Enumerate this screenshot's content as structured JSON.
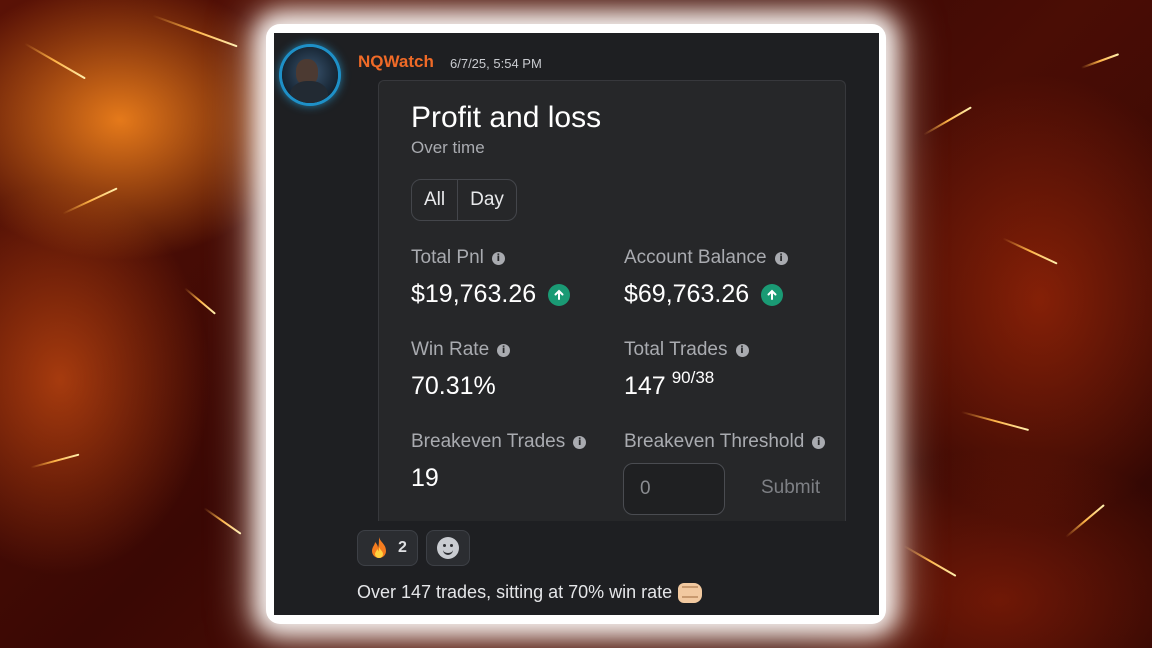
{
  "post": {
    "username": "NQWatch",
    "timestamp": "6/7/25, 5:54 PM"
  },
  "card": {
    "title": "Profit and loss",
    "subtitle": "Over time",
    "tabs": [
      "All",
      "Day"
    ],
    "stats": {
      "total_pnl_label": "Total Pnl",
      "total_pnl_value": "$19,763.26",
      "account_balance_label": "Account Balance",
      "account_balance_value": "$69,763.26",
      "win_rate_label": "Win Rate",
      "win_rate_value": "70.31%",
      "total_trades_label": "Total Trades",
      "total_trades_value": "147",
      "total_trades_split": "90/38",
      "breakeven_trades_label": "Breakeven Trades",
      "breakeven_trades_value": "19",
      "breakeven_threshold_label": "Breakeven Threshold"
    },
    "threshold_input": {
      "placeholder": "0"
    },
    "submit_label": "Submit"
  },
  "reactions": [
    {
      "icon": "fire-icon",
      "count": "2"
    },
    {
      "icon": "add-reaction-icon"
    }
  ],
  "message": {
    "text": "Over 147 trades, sitting at 70% win rate",
    "emoji": "fist-icon"
  },
  "colors": {
    "username": "#f06a27",
    "up_badge": "#1a9a74",
    "panel_bg": "#1e1f22",
    "card_bg": "#262729"
  }
}
